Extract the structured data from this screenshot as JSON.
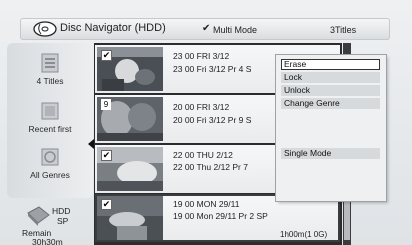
{
  "header": {
    "title": "Disc Navigator (HDD)",
    "mode_label": "Multi Mode",
    "title_count": "3Titles"
  },
  "sidebar": {
    "items": [
      {
        "label": "4 Titles",
        "icon": "list-icon"
      },
      {
        "label": "Recent first",
        "icon": "recent-icon"
      },
      {
        "label": "All Genres",
        "icon": "genre-icon"
      }
    ]
  },
  "status": {
    "drive": "HDD",
    "rec_mode": "SP",
    "remain_label": "Remain",
    "remain_time": "30h30m"
  },
  "titles": [
    {
      "checked": true,
      "number": "",
      "line1": "23 00  FRI  3/12",
      "line2": "23 00  Fri  3/12  Pr 4  S"
    },
    {
      "checked": false,
      "number": "9",
      "line1": "20 00  FRI  3/12",
      "line2": "20 00   Fri  3/12  Pr 9  S"
    },
    {
      "checked": true,
      "number": "",
      "line1": "22 00  THU  2/12",
      "line2": "22 00   Thu  2/12  Pr 7"
    },
    {
      "checked": true,
      "number": "",
      "line1": "19 00  MON  29/11",
      "line2": "19 00  Mon  29/11  Pr 2  SP",
      "duration": "1h00m(1 0G)"
    }
  ],
  "menu": {
    "items": [
      "Erase",
      "Lock",
      "Unlock",
      "Change Genre",
      "Single Mode"
    ],
    "active": "Erase"
  },
  "colors": {
    "accent": "#2a2c2e",
    "panel": "#d9dcdf",
    "menu_bg": "#eef0f2"
  }
}
